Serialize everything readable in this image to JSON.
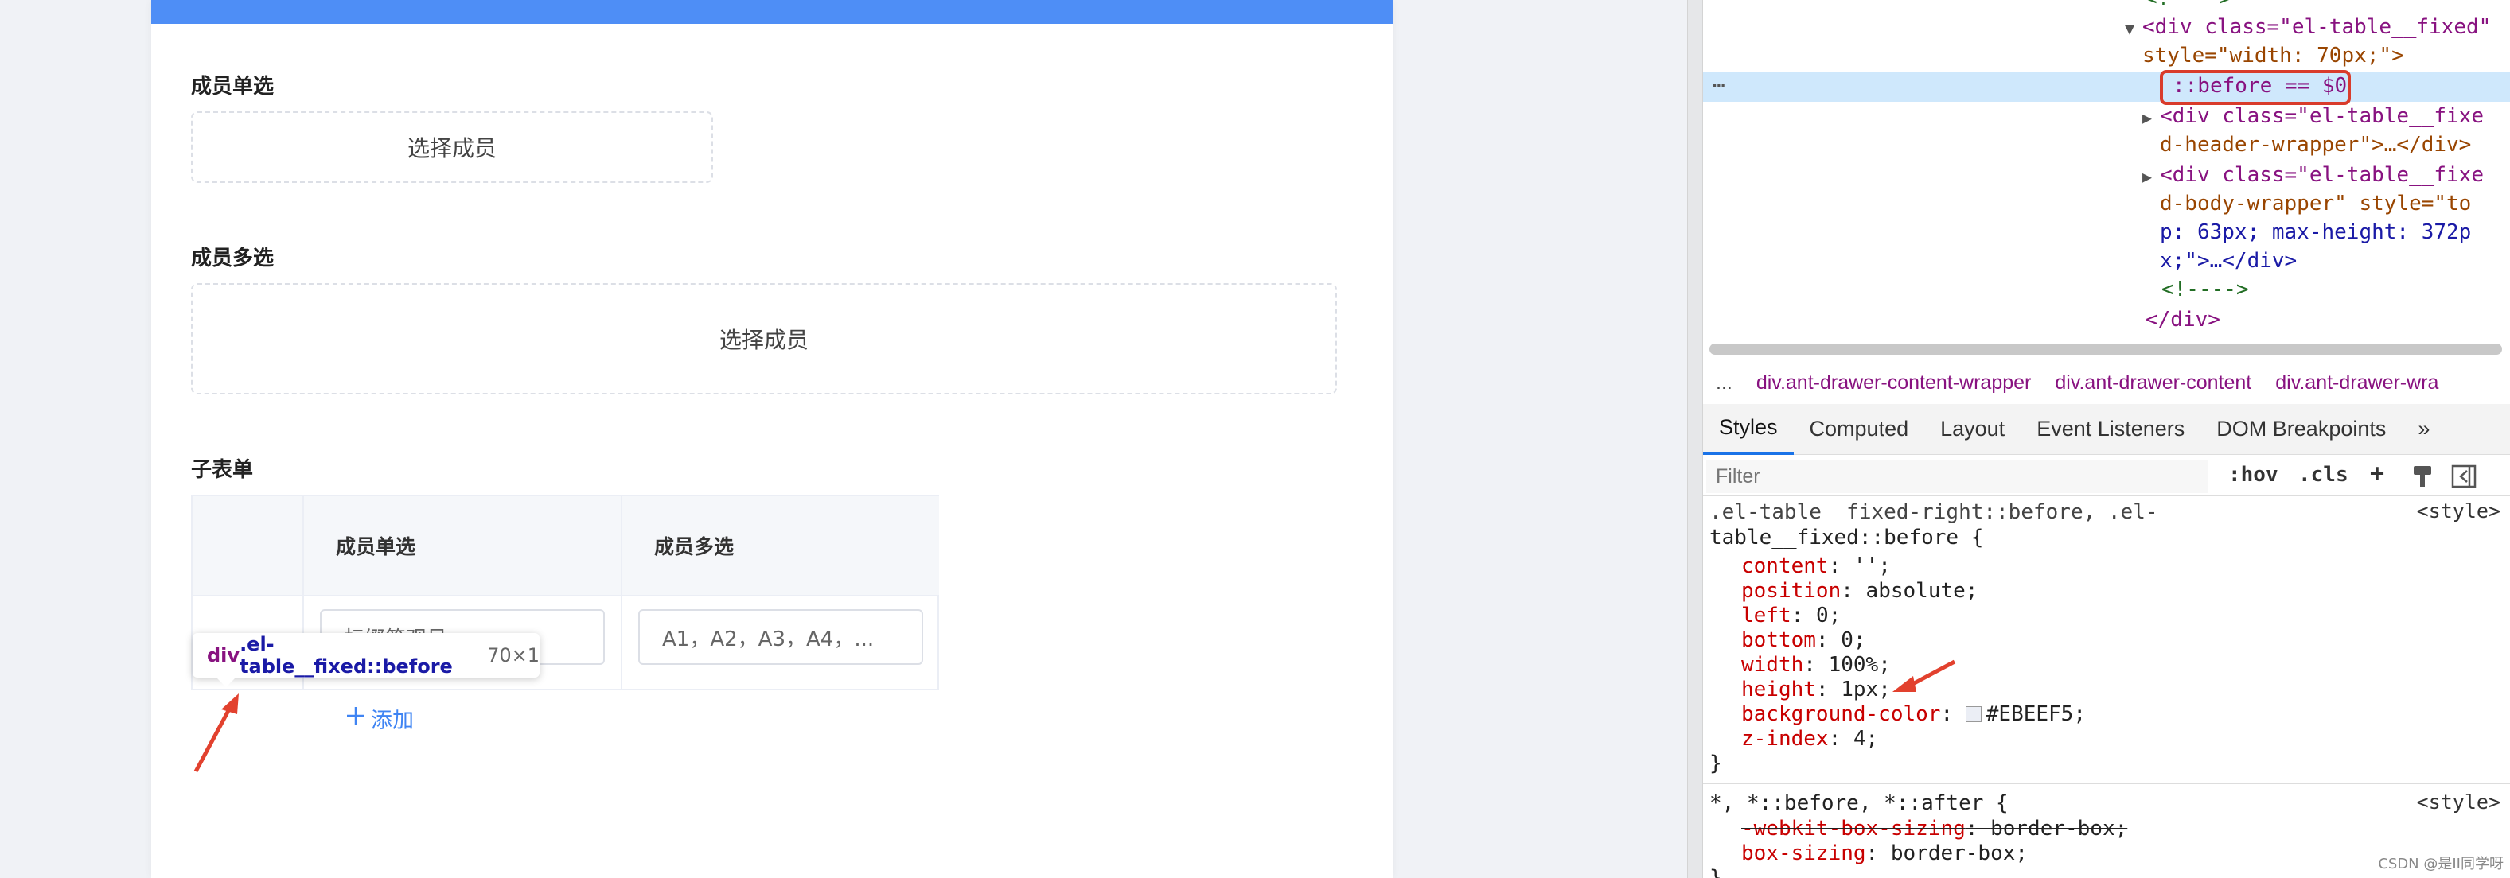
{
  "form": {
    "single_label": "成员单选",
    "single_picker": "选择成员",
    "multi_label": "成员多选",
    "multi_picker": "选择成员",
    "subform_label": "子表单",
    "table": {
      "headers": [
        "成员单选",
        "成员多选"
      ],
      "row_single": "标缀简观号",
      "row_multi": "A1，A2，A3，A4，..."
    },
    "add_label": "添加"
  },
  "tooltip": {
    "tag": "div",
    "cls": ".el-table__fixed::before",
    "dims": "70×1"
  },
  "devtools": {
    "dom_lines": [
      [
        "<!---->"
      ],
      [
        "<div class=\"el-table__fixed\""
      ],
      [
        "style=\"width: 70px;\">"
      ],
      [
        "::before == $0"
      ],
      [
        "<div class=\"el-table__fixe"
      ],
      [
        "d-header-wrapper\">…</div>"
      ],
      [
        "<div class=\"el-table__fixe"
      ],
      [
        "d-body-wrapper\" style=\"to"
      ],
      [
        "p: 63px; max-height: 372p"
      ],
      [
        "x;\">…</div>"
      ],
      [
        "<!---->"
      ],
      [
        "</div>"
      ]
    ],
    "crumbs": [
      "...",
      "div.ant-drawer-content-wrapper",
      "div.ant-drawer-content",
      "div.ant-drawer-wra"
    ],
    "tabs": [
      "Styles",
      "Computed",
      "Layout",
      "Event Listeners",
      "DOM Breakpoints",
      "»"
    ],
    "filter_placeholder": "Filter",
    "toolbar": {
      "hov": ":hov",
      "cls": ".cls",
      "plus": "+"
    },
    "rule1": {
      "selector_a": ".el-table__fixed-right::before, .el-",
      "selector_b": "table__fixed::before {",
      "source": "<style>",
      "props": [
        {
          "k": "content",
          "v": "'';"
        },
        {
          "k": "position",
          "v": "absolute;"
        },
        {
          "k": "left",
          "v": "0;"
        },
        {
          "k": "bottom",
          "v": "0;"
        },
        {
          "k": "width",
          "v": "100%;"
        },
        {
          "k": "height",
          "v": "1px;"
        },
        {
          "k": "background-color",
          "v": "#EBEEF5;"
        },
        {
          "k": "z-index",
          "v": "4;"
        }
      ],
      "close": "}"
    },
    "rule2": {
      "selector": "*, *::before, *::after {",
      "source": "<style>",
      "p1k": "-webkit-box-sizing",
      "p1v": "border-box;",
      "p2k": "box-sizing",
      "p2v": "border-box;",
      "close": "}"
    },
    "colors": {
      "swatch": "#EBEEF5",
      "accent": "#1a73e8",
      "annotation": "#d93c2c"
    }
  },
  "watermark": "CSDN @是II同学呀"
}
